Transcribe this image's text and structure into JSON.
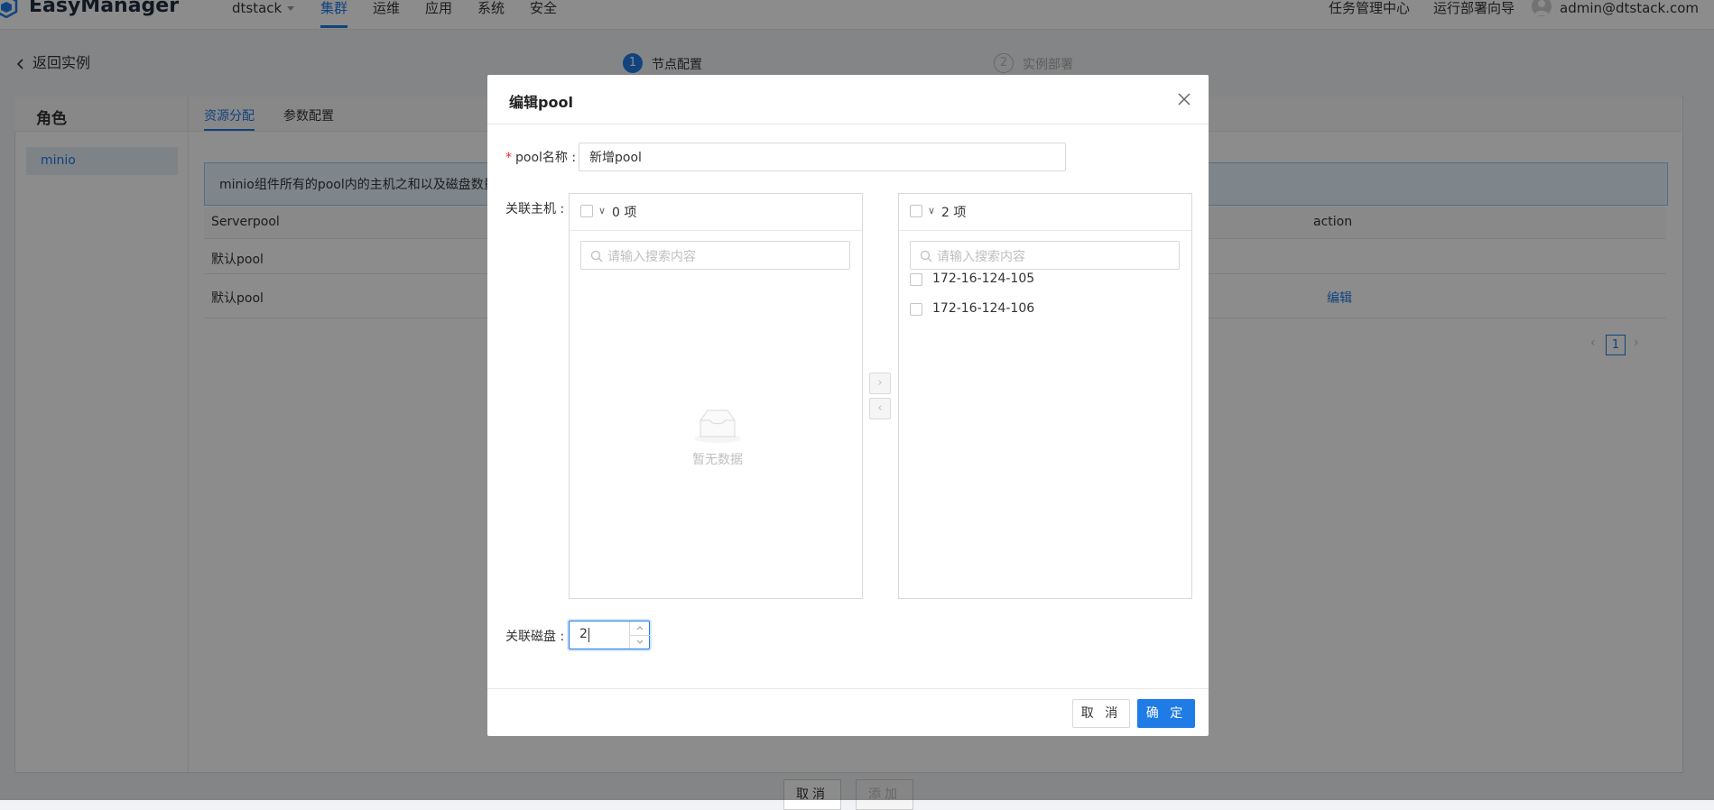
{
  "header": {
    "logo_text": "EasyManager",
    "cluster_select": "dtstack",
    "nav": [
      "集群",
      "运维",
      "应用",
      "系统",
      "安全"
    ],
    "right_links": [
      "任务管理中心",
      "运行部署向导"
    ],
    "user": "admin@dtstack.com"
  },
  "page": {
    "back_label": "返回实例",
    "steps": [
      {
        "num": "1",
        "label": "节点配置",
        "status": "active"
      },
      {
        "num": "2",
        "label": "实例部署",
        "status": "waiting"
      }
    ],
    "role_title": "角色",
    "tabs": [
      "资源分配",
      "参数配置"
    ],
    "roles": [
      "minio"
    ],
    "alert_text": "minio组件所有的pool内的主机之和以及磁盘数量",
    "table": {
      "headers": [
        "Serverpool",
        "action"
      ],
      "rows": [
        {
          "name": "默认pool",
          "action": ""
        },
        {
          "name": "默认pool",
          "action": "编辑"
        }
      ]
    },
    "pagination": {
      "current": "1"
    },
    "bottom_buttons": [
      "取消",
      "添加"
    ]
  },
  "modal": {
    "title": "编辑pool",
    "pool_name_label": "pool名称",
    "pool_name_value": "新增pool",
    "hosts_label": "关联主机",
    "left_panel": {
      "count_label": "0 项",
      "search_placeholder": "请输入搜索内容",
      "empty_text": "暂无数据",
      "items": []
    },
    "right_panel": {
      "count_label": "2 项",
      "search_placeholder": "请输入搜索内容",
      "items": [
        "172-16-124-105",
        "172-16-124-106"
      ]
    },
    "disk_label": "关联磁盘",
    "disk_value": "2",
    "cancel_label": "取 消",
    "ok_label": "确 定"
  },
  "colors": {
    "primary": "#1f7be6",
    "mask": "rgba(0,0,0,0.45)",
    "required": "#f5222d"
  }
}
